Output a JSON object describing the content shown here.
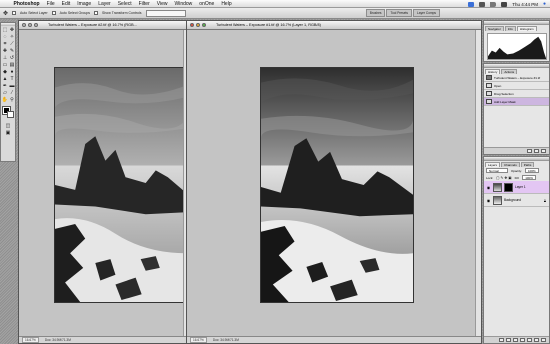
{
  "menubar": {
    "items": [
      "Photoshop",
      "File",
      "Edit",
      "Image",
      "Layer",
      "Select",
      "Filter",
      "View",
      "Window",
      "onOne",
      "Help"
    ],
    "clock": "Thu 4:44 PM"
  },
  "optionsbar": {
    "auto_select_layer": "Auto Select Layer",
    "auto_select_groups": "Auto Select Groups",
    "show_transform_controls": "Show Transform Controls",
    "well_tabs": [
      "Brushes",
      "Tool Presets",
      "Layer Comps"
    ]
  },
  "doc_left": {
    "title": "Turbulent Waters – Exposure #2.tif @ 16.7% (RGB…",
    "zoom": "16.67%",
    "doc_size": "Doc: 34.9M/71.3M"
  },
  "doc_right": {
    "title": "Turbulent Waters – Exposure #1.tif @ 16.7% (Layer 1, RGB/8)",
    "zoom": "16.67%",
    "doc_size": "Doc: 34.9M/71.3M"
  },
  "navigator": {
    "tabs": [
      "Navigator",
      "Info",
      "Histogram"
    ]
  },
  "history": {
    "tabs": [
      "History",
      "Actions"
    ],
    "rows": [
      {
        "label": "Turbulent Waters – Exposure #1.tif"
      },
      {
        "label": "Open"
      },
      {
        "label": "Drag Selection"
      },
      {
        "label": "Add Layer Mask"
      }
    ]
  },
  "layers": {
    "tabs": [
      "Layers",
      "Channels",
      "Paths"
    ],
    "blend_mode": "Normal",
    "opacity_label": "Opacity:",
    "opacity": "100%",
    "lock_label": "Lock:",
    "fill_label": "Fill:",
    "fill": "100%",
    "rows": [
      {
        "name": "Layer 1"
      },
      {
        "name": "Background"
      }
    ]
  },
  "colors": {
    "selection_purple": "#cdb6e0",
    "layer_selected": "#e3c6f3",
    "canvas_gray": "#c4c4c4"
  }
}
